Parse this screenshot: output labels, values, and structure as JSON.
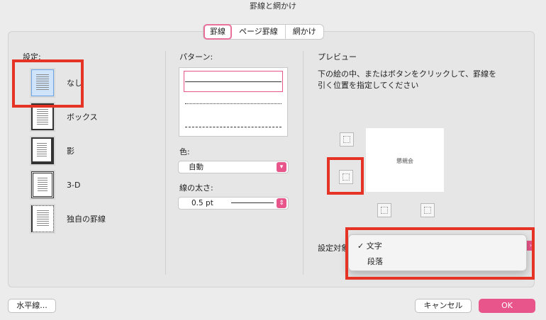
{
  "window": {
    "title": "罫線と網かけ"
  },
  "tabs": [
    "罫線",
    "ページ罫線",
    "網かけ"
  ],
  "settings": {
    "label": "設定:",
    "items": [
      {
        "label": "なし",
        "icon": "border-none-icon"
      },
      {
        "label": "ボックス",
        "icon": "border-box-icon"
      },
      {
        "label": "影",
        "icon": "border-shadow-icon"
      },
      {
        "label": "3-D",
        "icon": "border-3d-icon"
      },
      {
        "label": "独自の罫線",
        "icon": "border-custom-icon"
      }
    ]
  },
  "pattern": {
    "label": "パターン:",
    "styles": [
      "solid",
      "dotted",
      "dashed"
    ]
  },
  "color": {
    "label": "色:",
    "value": "自動"
  },
  "width": {
    "label": "線の太さ:",
    "value": "0.5 pt"
  },
  "preview": {
    "label": "プレビュー",
    "instructions_line1": "下の絵の中、またはボタンをクリックして、罫線を",
    "instructions_line2": "引く位置を指定してください",
    "sample_text": "懇親会"
  },
  "apply_to": {
    "label": "設定対象",
    "options": [
      "文字",
      "段落"
    ],
    "selected": "文字",
    "checkmark": "✓"
  },
  "buttons": {
    "horizontal_line": "水平線...",
    "cancel": "キャンセル",
    "ok": "OK"
  },
  "colors": {
    "accent": "#e8558a",
    "highlight": "#e53326"
  }
}
